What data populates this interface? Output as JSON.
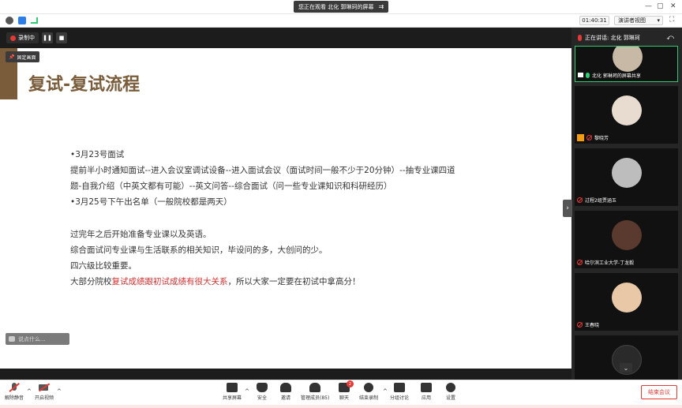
{
  "titlebar": {
    "viewing_banner": "您正在观看 北化 郭琳珂的屏幕",
    "banner_icon": "stop-share-icon",
    "window_controls": [
      "—",
      "▢",
      "✕"
    ]
  },
  "toolbar2": {
    "timer": "01:40:31",
    "view_mode": "演讲者视图",
    "view_mode_caret": "▾",
    "fullscreen_glyph": "⛶"
  },
  "recording": {
    "label": "录制中",
    "pause_glyph": "❚❚",
    "stop_glyph": "■"
  },
  "slide": {
    "pin_tip": "固定画面",
    "title": "复试-复试流程",
    "lines": [
      "•3月23号面试",
      "提前半小时通知面试--进入会议室调试设备--进入面试会议（面试时间一般不少于20分钟）--抽专业课四道",
      "题-自我介绍（中英文都有可能）--英文问答--综合面试（问一些专业课知识和科研经历）",
      "•3月25号下午出名单（一般院校都是两天）",
      "",
      "过完年之后开始准备专业课以及英语。",
      "综合面试问专业课与生活联系的相关知识，毕设问的多，大创问的少。",
      "四六级比较重要。"
    ],
    "last_line_prefix": "大部分院校",
    "last_line_highlight": "复试成绩跟初试成绩有很大关系",
    "last_line_suffix": "，所以大家一定要在初试中拿高分！",
    "chat_placeholder": "说点什么..."
  },
  "right_panel": {
    "speaking": "正在讲话: 北化 郭琳珂",
    "participants": [
      {
        "name": "北化 郭琳珂的屏幕共享",
        "avatar_color": "#c8b9a6",
        "active": true,
        "muted": false
      },
      {
        "name": "黎晓芳",
        "avatar_color": "#e8dcd0",
        "active": false,
        "muted": true
      },
      {
        "name": "过程2组贾涵玉",
        "avatar_color": "#bdbdbd",
        "active": false,
        "muted": true
      },
      {
        "name": "哈尔滨工业大学-丁龙毅",
        "avatar_color": "#5a3a2e",
        "active": false,
        "muted": true
      },
      {
        "name": "王春晓",
        "avatar_color": "#e9c8a8",
        "active": false,
        "muted": true
      },
      {
        "name": "",
        "avatar_color": "#2a2a2a",
        "active": false,
        "muted": false
      }
    ]
  },
  "bottom_toolbar": {
    "unmute": "解除静音",
    "start_video": "开启视频",
    "share_screen": "共享屏幕",
    "security": "安全",
    "invite": "邀请",
    "manage_members": "管理成员(85)",
    "chat": "聊天",
    "chat_badge": "2",
    "record": "结束录制",
    "breakout": "分组讨论",
    "apps": "应用",
    "settings": "设置",
    "end_meeting": "结束会议"
  },
  "colors": {
    "accent_brown": "#7a5c3a",
    "highlight_red": "#d32f2f",
    "active_green": "#2ecc71"
  }
}
